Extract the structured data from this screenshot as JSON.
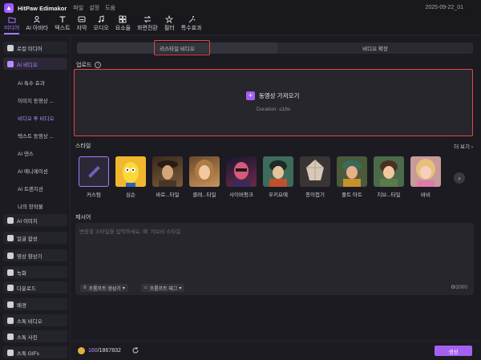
{
  "titlebar": {
    "app_title": "HitPaw Edimakor",
    "menu": [
      "파일",
      "설정",
      "도움"
    ],
    "date": "2025-09-22_01"
  },
  "toolbar": {
    "items": [
      {
        "label": "미디어",
        "icon": "folder-icon",
        "active": true
      },
      {
        "label": "AI 아바타",
        "icon": "avatar-icon",
        "active": false
      },
      {
        "label": "텍스트",
        "icon": "text-icon",
        "active": false
      },
      {
        "label": "자막",
        "icon": "subtitle-icon",
        "active": false
      },
      {
        "label": "오디오",
        "icon": "music-icon",
        "active": false
      },
      {
        "label": "요소들",
        "icon": "elements-icon",
        "active": false
      },
      {
        "label": "화면전환",
        "icon": "transition-icon",
        "active": false
      },
      {
        "label": "필터",
        "icon": "filter-icon",
        "active": false
      },
      {
        "label": "특수효과",
        "icon": "effects-icon",
        "active": false
      }
    ]
  },
  "sidebar": {
    "local_media": "로컬 미디어",
    "ai_video": "AI 비디오",
    "sub_items": [
      "AI 특수 효과",
      "이미지 동영상 ...",
      "비디오 투 비디오",
      "텍스트 동영상 ...",
      "AI 댄스",
      "AI 애니메이션",
      "AI 트랜지션",
      "나의 창작물"
    ],
    "groups": [
      "AI 이미지",
      "얼굴 합성",
      "영상 향상기",
      "녹화",
      "다운로드",
      "배경",
      "스톡 비디오",
      "스톡 사진",
      "스톡 GIFs"
    ]
  },
  "main": {
    "tabs": {
      "left": "리스타일 비디오",
      "right": "비디오 확장"
    },
    "upload": {
      "label": "업로드",
      "button": "동영상 가져오기",
      "duration": "Duration: ≤16s"
    },
    "style": {
      "label": "스타일",
      "more": "더 보기",
      "items": [
        "커스텀",
        "심슨",
        "바로...타일",
        "클레...타일",
        "사이버펑크",
        "우키요에",
        "종이접기",
        "폴트 아트",
        "지브...타일",
        "바비"
      ]
    },
    "prompt": {
      "label": "제시어",
      "placeholder": "변환할 스타일을 입력하세요. 예: 지브리 스타일",
      "generator": "프롬프트 생성기",
      "tags": "프롬프트 태그",
      "count": "0",
      "max": "/2000"
    },
    "footer": {
      "credits_used": "160",
      "credits_total": "/1867832",
      "generate": "생성"
    }
  },
  "colors": {
    "accent": "#a77bff",
    "highlight": "#e04848",
    "button": "#a560f0"
  }
}
